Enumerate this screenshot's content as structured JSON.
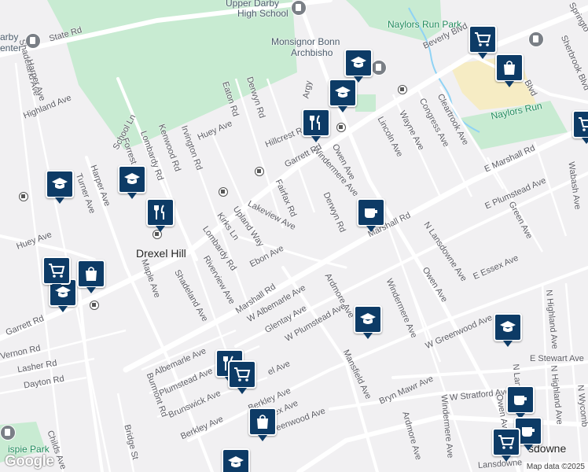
{
  "parks": [
    "Naylors Run Park",
    "Naylors Run",
    "ispie Park"
  ],
  "places": [
    "Drexel Hill",
    "sdowne"
  ],
  "pois": [
    "Upper Darby",
    "High School",
    "Monsignor Bonn",
    "Archbisho",
    "arby",
    "enter"
  ],
  "streets": {
    "state_rd": "State Rd",
    "shadeland_ave_1": "Shadeland Ave",
    "harper_ave_1": "Harper Ave",
    "highland_ave": "Highland Ave",
    "derwyn_rd_1": "Derwyn Rd",
    "eaton_rd": "Eaton Rd",
    "kenwood_rd": "Kenwood Rd",
    "lombardy_rd_1": "Lombardy Rd",
    "irvington_rd": "Irvington Rd",
    "huey_ave_1": "Huey Ave",
    "school_ln": "School Ln",
    "forrest_ave": "Forrest Ave",
    "harper_ave_2": "Harper Ave",
    "turner_ave": "Turner Ave",
    "hillcrest_rd": "Hillcrest Rd",
    "garrett_rd_1": "Garrett Rd",
    "windermere_ave_1": "Windermere Ave",
    "owen_ave_1": "Owen Ave",
    "fairfax_rd": "Fairfax Rd",
    "derwyn_rd_2": "Derwyn Rd",
    "lakeview_ave": "Lakeview Ave",
    "upland_way": "Upland Way",
    "kirks_ln": "Kirks Ln",
    "lombardy_rd_2": "Lombardy Rd",
    "huey_ave_2": "Huey Ave",
    "ebon_ave": "Ebon Ave",
    "riverview_ave": "Riverview Ave",
    "maple_ave": "Maple Ave",
    "shadeland_ave_2": "Shadeland Ave",
    "marshall_rd_1": "Marshall Rd",
    "marshall_rd_2": "Marshall Rd",
    "e_marshall_rd": "E Marshall Rd",
    "e_plumstead_ave": "E Plumstead Ave",
    "n_lansdowne_ave": "N Lansdowne Ave",
    "wabash_ave": "Wabash Ave",
    "green_ave": "Green Ave",
    "e_essex_ave": "E Essex Ave",
    "owen_ave_2": "Owen Ave",
    "windermere_ave_2": "Windermere Ave",
    "ardmore_ave_1": "Ardmore Ave",
    "w_albemarle_ave": "W Albemarle Ave",
    "glentay_ave": "Glentay Ave",
    "w_plumstead_ave": "W Plumstead Ave",
    "garrett_rd_2": "Garrett Rd",
    "vernon_rd": "Vernon Rd",
    "lasher_rd": "Lasher Rd",
    "dayton_rd": "Dayton Rd",
    "albemarle_ave": "Albemarle Ave",
    "plumstead_ave": "Plumstead Ave",
    "brunswick_ave": "Brunswick Ave",
    "berkley_ave_1": "Berkley Ave",
    "berkley_ave_2": "Berkley Ave",
    "burmont_rd": "Burmont Rd",
    "bridge_st": "Bridge St",
    "childs_ave": "Childs Ave",
    "mansfield_ave": "Mansfield Ave",
    "w_greenwood_ave_1": "W Greenwood Ave",
    "w_greenwood_ave_2": "W Greenwood Ave",
    "bryn_mawr_ave": "Bryn Mawr Ave",
    "w_stratford_ave": "W Stratford Ave",
    "ardmore_ave_2": "Ardmore Ave",
    "windermere_ave_3": "Windermere Ave",
    "owen_ave_3": "Owen Ave",
    "n_highland_ave_1": "N Highland Ave",
    "n_highland_ave_2": "N Highland Ave",
    "n_lansdowne_2": "N Lans",
    "w_wycombe": "N Wycomb",
    "e_stewart_ave": "E Stewart Ave",
    "lansdowne_ave": "Lansdowne",
    "cleartrook_ave": "Cleartrook Ave",
    "congress_ave": "Congress Ave",
    "wayne_ave": "Wayne Ave",
    "lincoln_ave": "Lincoln Ave",
    "beverly_blvd": "Beverly Blvd",
    "sherbrook_blvd": "Sherbrook Blvd",
    "springton": "Springto",
    "argyle": "Argy",
    "sex_ave": "sex Ave",
    "el_ave": "el Ave",
    "reenwood_ave": "reenwood Ave",
    "blvd": "Blvd"
  },
  "markers": {
    "school": "school-icon",
    "restaurant": "restaurant-icon",
    "cafe": "cafe-icon",
    "grocery": "shopping-cart-icon",
    "store": "shopping-bag-icon"
  },
  "colors": {
    "background": "#f1f0f2",
    "park": "#c8ebd2",
    "marker": "#0d3b66",
    "water": "#8fd3f5"
  },
  "attribution": "Map data ©2025",
  "logo": "Google"
}
